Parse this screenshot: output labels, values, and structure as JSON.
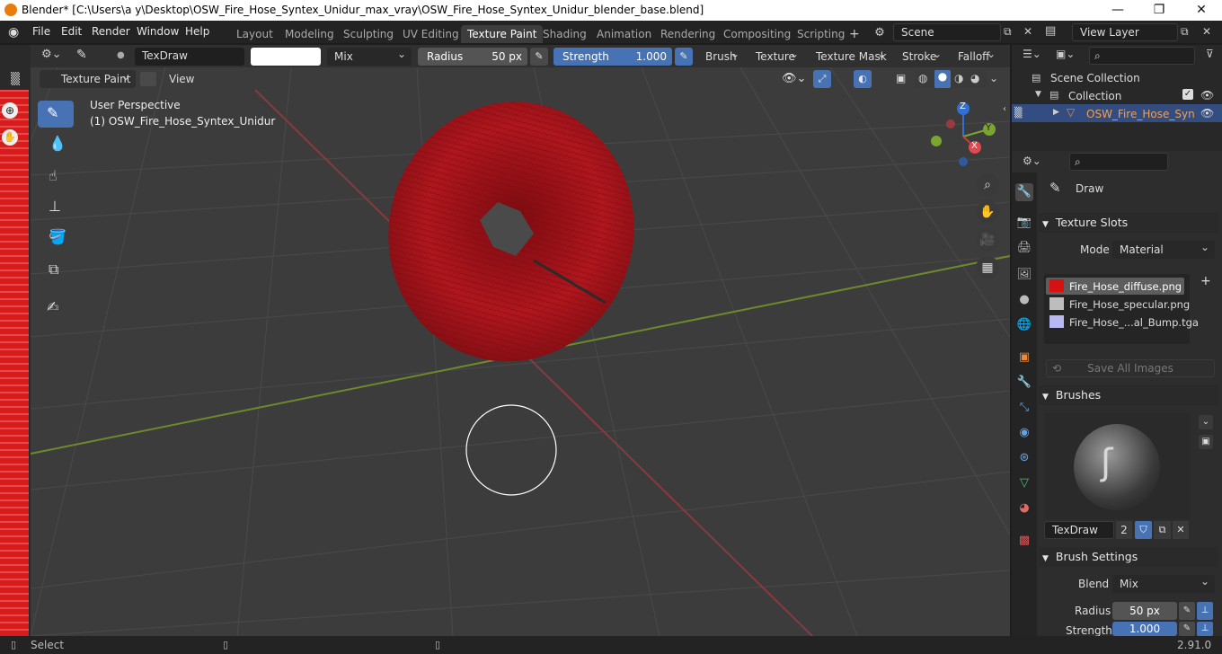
{
  "window": {
    "title": "Blender* [C:\\Users\\a y\\Desktop\\OSW_Fire_Hose_Syntex_Unidur_max_vray\\OSW_Fire_Hose_Syntex_Unidur_blender_base.blend]"
  },
  "menu": [
    "File",
    "Edit",
    "Render",
    "Window",
    "Help"
  ],
  "workspaces": [
    "Layout",
    "Modeling",
    "Sculpting",
    "UV Editing",
    "Texture Paint",
    "Shading",
    "Animation",
    "Rendering",
    "Compositing",
    "Scripting"
  ],
  "scene": {
    "name": "Scene",
    "view_layer": "View Layer"
  },
  "toolheader": {
    "brush_name": "TexDraw",
    "blend_mode": "Mix",
    "radius_label": "Radius",
    "radius_value": "50 px",
    "strength_label": "Strength",
    "strength_value": "1.000",
    "menus": [
      "Brush",
      "Texture",
      "Texture Mask",
      "Stroke",
      "Falloff"
    ]
  },
  "header2": {
    "mode": "Texture Paint",
    "view": "View"
  },
  "viewport": {
    "perspective": "User Perspective",
    "object": "(1) OSW_Fire_Hose_Syntex_Unidur"
  },
  "gizmo": {
    "z": "Z",
    "y": "Y",
    "x": "X"
  },
  "outliner": {
    "scene_collection": "Scene Collection",
    "collection": "Collection",
    "object": "OSW_Fire_Hose_Syn"
  },
  "properties": {
    "tool_name": "Draw",
    "texture_slots_title": "Texture Slots",
    "mode_label": "Mode",
    "mode_value": "Material",
    "slots": [
      {
        "name": "Fire_Hose_diffuse.png",
        "color": "#d51111"
      },
      {
        "name": "Fire_Hose_specular.png",
        "color": "#bdbdbd"
      },
      {
        "name": "Fire_Hose_...al_Bump.tga",
        "color": "#b8b8f2"
      }
    ],
    "save_all_images": "Save All Images",
    "brushes_title": "Brushes",
    "brush_name": "TexDraw",
    "brush_users": "2",
    "brush_settings_title": "Brush Settings",
    "blend_label": "Blend",
    "blend_value": "Mix",
    "radius_label": "Radius",
    "radius_value": "50 px",
    "strength_label": "Strength",
    "strength_value": "1.000"
  },
  "statusbar": {
    "select": "Select",
    "version": "2.91.0"
  },
  "colors": {
    "accent": "#4772b3",
    "active_slot": "#5d5d5d",
    "hose_red": "#a8141b",
    "ui_bg": "#303030"
  }
}
